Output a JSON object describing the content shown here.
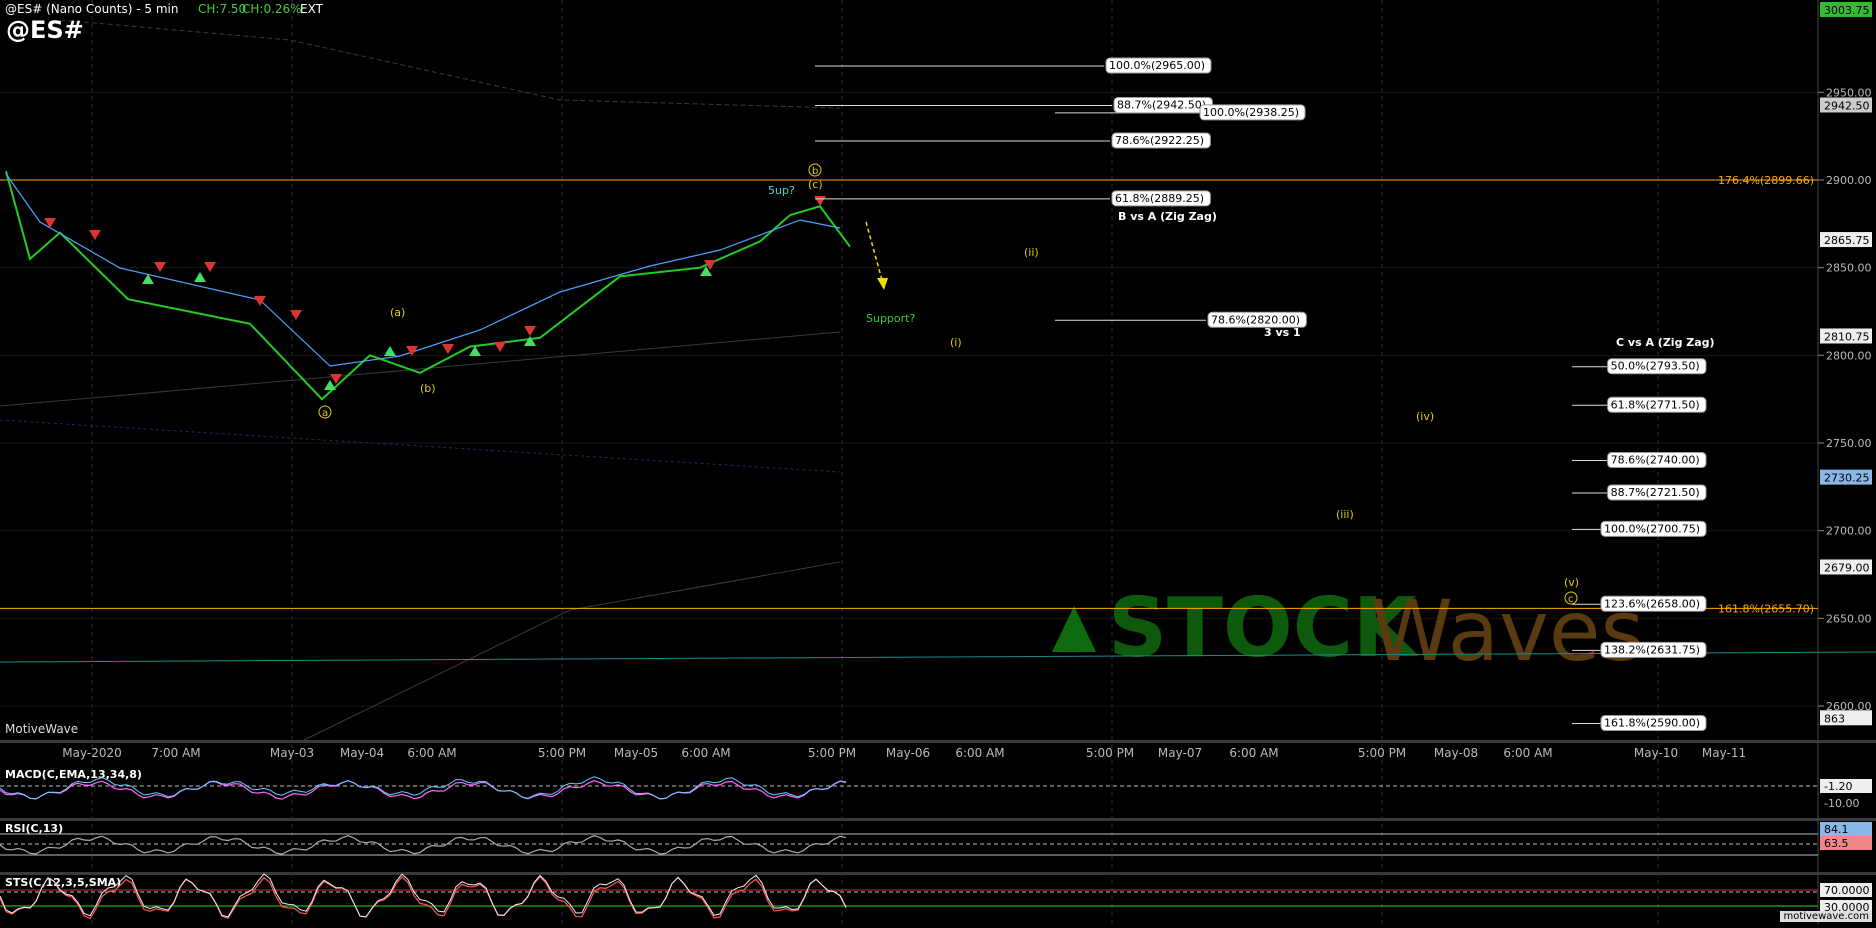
{
  "header": {
    "title": "@ES# (Nano Counts) - 5 min",
    "change_pts": "CH:7.50",
    "change_pct": "CH:0.26%",
    "session": "EXT",
    "symbol": "@ES#"
  },
  "brand": "MotiveWave",
  "footer_brand": "motivewave.com",
  "colors": {
    "background": "#000000",
    "up_candle": "#22cc22",
    "down_candle": "#dd3333",
    "ma_line": "#4da3ff",
    "fib_orange": "#ffaa00",
    "wave_yellow": "#e0d000",
    "support_green": "#33cc33",
    "teal_line": "#1e8a8a"
  },
  "x_labels": [
    "May-2020",
    "7:00 AM",
    "May-03",
    "May-04",
    "6:00 AM",
    "5:00 PM",
    "May-05",
    "6:00 AM",
    "5:00 PM",
    "May-06",
    "6:00 AM",
    "5:00 PM",
    "May-07",
    "6:00 AM",
    "5:00 PM",
    "May-08",
    "6:00 AM",
    "May-10",
    "May-11"
  ],
  "chart_data": [
    {
      "type": "line",
      "title": "@ES# (Nano Counts) - 5 min",
      "y_ticks": [
        2600,
        2650,
        2700,
        2750,
        2800,
        2850,
        2900,
        2950
      ],
      "ylim": [
        2588,
        3008
      ],
      "price_tags": [
        "3003.75",
        "2942.50",
        "2865.75",
        "2810.75",
        "2730.25",
        "2679.00",
        "863"
      ],
      "series": [
        {
          "x": [
            "May-01",
            "May-01",
            "May-01",
            "May-01",
            "May-03",
            "May-03",
            "May-04",
            "May-04",
            "May-04",
            "May-04",
            "May-05",
            "May-05",
            "May-05",
            "May-05",
            "May-05",
            "May-05"
          ],
          "values": [
            2905,
            2855,
            2870,
            2832,
            2818,
            2775,
            2800,
            2790,
            2805,
            2810,
            2845,
            2850,
            2865,
            2880,
            2885,
            2862
          ]
        }
      ],
      "fib_levels_top": [
        {
          "label": "100.0%(2965.00)"
        },
        {
          "label": "88.7%(2942.50)"
        },
        {
          "label": "100.0%(2938.25)"
        },
        {
          "label": "78.6%(2922.25)"
        },
        {
          "label": "61.8%(2889.25)"
        },
        {
          "label": "78.6%(2820.00)"
        }
      ],
      "fib_levels_c_vs_a": [
        {
          "label": "50.0%(2793.50)"
        },
        {
          "label": "61.8%(2771.50)"
        },
        {
          "label": "78.6%(2740.00)"
        },
        {
          "label": "88.7%(2721.50)"
        },
        {
          "label": "100.0%(2700.75)"
        },
        {
          "label": "123.6%(2658.00)"
        },
        {
          "label": "138.2%(2631.75)"
        },
        {
          "label": "161.8%(2590.00)"
        }
      ],
      "extension_labels": [
        "176.4%(2899.66)",
        "161.8%(2655.70)"
      ],
      "annotations": [
        "B vs A (Zig Zag)",
        "3 vs 1",
        "C vs A (Zig Zag)",
        "Support?",
        "5up?",
        "(a)",
        "(b)",
        "(c)",
        "(i)",
        "(ii)",
        "(iii)",
        "(iv)",
        "(v)",
        "a",
        "b",
        "c"
      ],
      "watermark": "STOCK Waves"
    },
    {
      "type": "line",
      "title": "MACD(C,EMA,13,34,8)",
      "value_tags": [
        "-1.20",
        "-10.00"
      ]
    },
    {
      "type": "line",
      "title": "RSI(C,13)",
      "value_tags": [
        "84.1",
        "63.5"
      ]
    },
    {
      "type": "line",
      "title": "STS(C,12,3,5,SMA)",
      "value_tags": [
        "70.0000",
        "30.0000"
      ]
    }
  ]
}
